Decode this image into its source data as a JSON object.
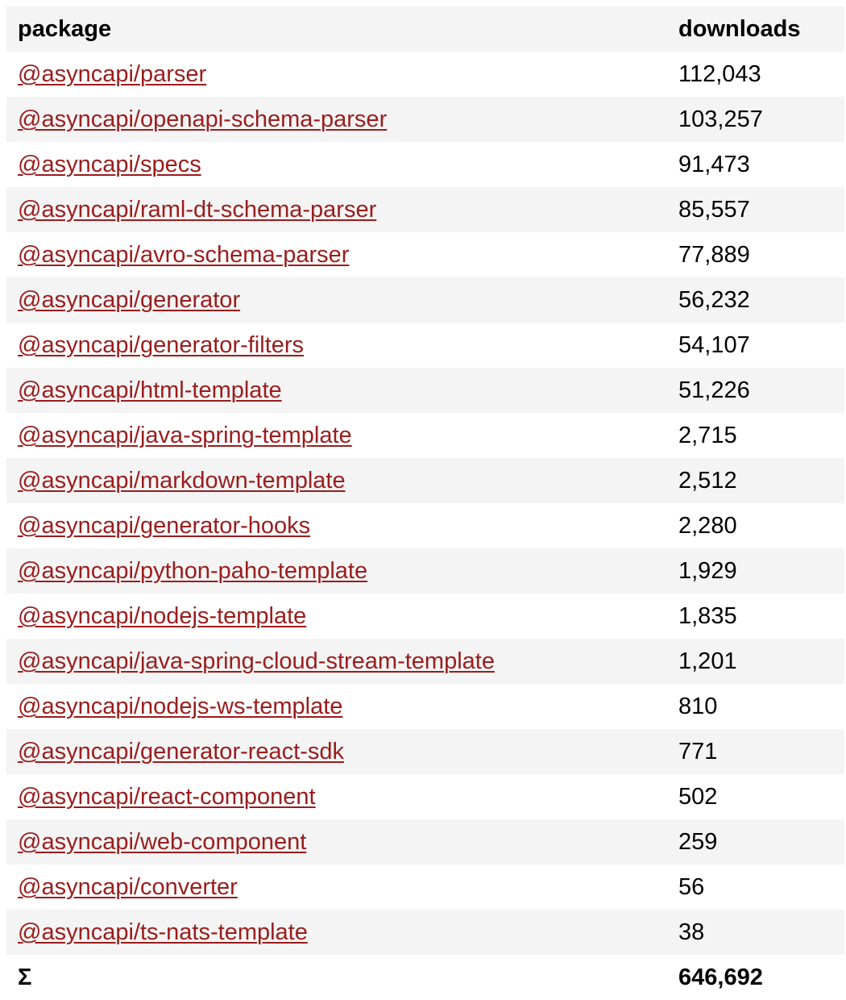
{
  "table": {
    "headers": {
      "package": "package",
      "downloads": "downloads"
    },
    "rows": [
      {
        "package": "@asyncapi/parser",
        "downloads": "112,043"
      },
      {
        "package": "@asyncapi/openapi-schema-parser",
        "downloads": "103,257"
      },
      {
        "package": "@asyncapi/specs",
        "downloads": "91,473"
      },
      {
        "package": "@asyncapi/raml-dt-schema-parser",
        "downloads": "85,557"
      },
      {
        "package": "@asyncapi/avro-schema-parser",
        "downloads": "77,889"
      },
      {
        "package": "@asyncapi/generator",
        "downloads": "56,232"
      },
      {
        "package": "@asyncapi/generator-filters",
        "downloads": "54,107"
      },
      {
        "package": "@asyncapi/html-template",
        "downloads": "51,226"
      },
      {
        "package": "@asyncapi/java-spring-template",
        "downloads": "2,715"
      },
      {
        "package": "@asyncapi/markdown-template",
        "downloads": "2,512"
      },
      {
        "package": "@asyncapi/generator-hooks",
        "downloads": "2,280"
      },
      {
        "package": "@asyncapi/python-paho-template",
        "downloads": "1,929"
      },
      {
        "package": "@asyncapi/nodejs-template",
        "downloads": "1,835"
      },
      {
        "package": "@asyncapi/java-spring-cloud-stream-template",
        "downloads": "1,201"
      },
      {
        "package": "@asyncapi/nodejs-ws-template",
        "downloads": "810"
      },
      {
        "package": "@asyncapi/generator-react-sdk",
        "downloads": "771"
      },
      {
        "package": "@asyncapi/react-component",
        "downloads": "502"
      },
      {
        "package": "@asyncapi/web-component",
        "downloads": "259"
      },
      {
        "package": "@asyncapi/converter",
        "downloads": "56"
      },
      {
        "package": "@asyncapi/ts-nats-template",
        "downloads": "38"
      }
    ],
    "total": {
      "label": "Σ",
      "downloads": "646,692"
    }
  },
  "colors": {
    "link": "#9b1c1c",
    "stripe": "#f4f4f4"
  }
}
